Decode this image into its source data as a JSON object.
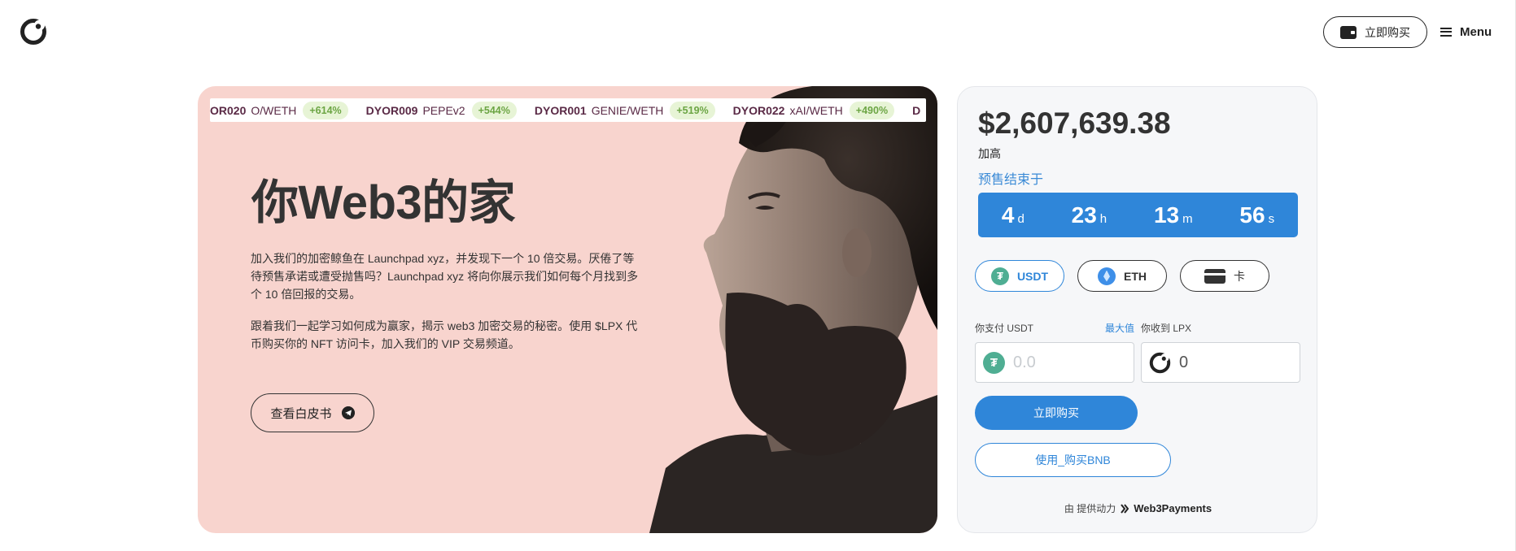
{
  "header": {
    "buy_label": "立即购买",
    "menu_label": "Menu"
  },
  "hero": {
    "ticker": [
      {
        "code": "OR020",
        "pair": "O/WETH",
        "change": "+614%"
      },
      {
        "code": "DYOR009",
        "pair": "PEPEv2",
        "change": "+544%"
      },
      {
        "code": "DYOR001",
        "pair": "GENIE/WETH",
        "change": "+519%"
      },
      {
        "code": "DYOR022",
        "pair": "xAI/WETH",
        "change": "+490%"
      },
      {
        "code": "D",
        "pair": "",
        "change": ""
      }
    ],
    "title": "你Web3的家",
    "paragraph1": "加入我们的加密鲸鱼在 Launchpad xyz，并发现下一个 10 倍交易。厌倦了等待预售承诺或遭受抛售吗？Launchpad xyz 将向你展示我们如何每个月找到多个 10 倍回报的交易。",
    "paragraph2": "跟着我们一起学习如何成为赢家，揭示 web3 加密交易的秘密。使用 $LPX 代币购买你的 NFT 访问卡，加入我们的 VIP 交易频道。",
    "whitepaper_label": "查看白皮书"
  },
  "presale": {
    "raised_amount": "$2,607,639.38",
    "raised_label": "加高",
    "ends_label": "预售结束于",
    "countdown": [
      {
        "value": "4",
        "unit": "d"
      },
      {
        "value": "23",
        "unit": "h"
      },
      {
        "value": "13",
        "unit": "m"
      },
      {
        "value": "56",
        "unit": "s"
      }
    ],
    "currencies": {
      "usdt": "USDT",
      "eth": "ETH",
      "card": "卡"
    },
    "pay_label": "你支付 USDT",
    "max_label": "最大值",
    "receive_label": "你收到 LPX",
    "pay_placeholder": "0.0",
    "receive_value": "0",
    "buy_label": "立即购买",
    "bnb_label": "使用_购买BNB",
    "powered_prefix": "由 提供动力",
    "powered_brand": "Web3Payments"
  },
  "colors": {
    "accent": "#2f86d9",
    "hero_bg": "#f8d4ce",
    "ticker_text": "#5a2a46",
    "ticker_pct_bg": "#e7f4d6",
    "ticker_pct_text": "#6ca544",
    "usdt_green": "#4fae93"
  }
}
